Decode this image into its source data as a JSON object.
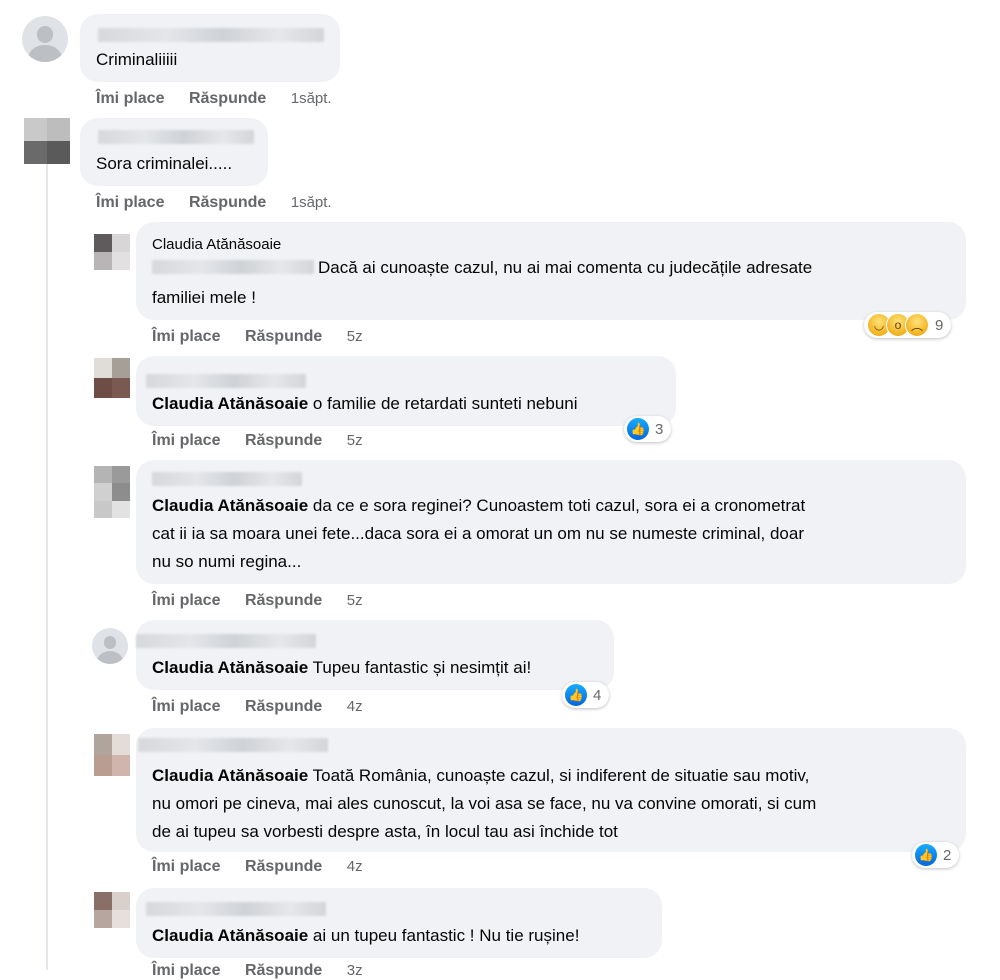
{
  "labels": {
    "like": "Îmi place",
    "reply": "Răspunde"
  },
  "comments": [
    {
      "text": "Criminaliiiii",
      "time": "1săpt."
    },
    {
      "text": "Sora criminalei.....",
      "time": "1săpt."
    },
    {
      "author": "Claudia Atănăsoaie",
      "text": "Dacă ai cunoaște cazul, nu ai mai comenta cu judecățile adresate",
      "text2": "familiei mele !",
      "time": "5z",
      "reactions": {
        "count": "9",
        "icons": [
          "haha-icon",
          "wow-icon",
          "sad-icon"
        ]
      }
    },
    {
      "mention": "Claudia Atănăsoaie",
      "text": " o familie de retardati sunteti nebuni",
      "time": "5z",
      "reactions": {
        "count": "3",
        "icons": [
          "like-icon"
        ]
      }
    },
    {
      "mention": "Claudia Atănăsoaie",
      "text": " da ce e sora reginei? Cunoastem toti cazul, sora ei a cronometrat",
      "text2": "cat ii ia sa moara unei fete...daca sora ei a omorat un om nu se numeste criminal, doar",
      "text3": "nu so numi regina...",
      "time": "5z"
    },
    {
      "mention": "Claudia Atănăsoaie",
      "text": " Tupeu fantastic și nesimțit ai!",
      "time": "4z",
      "reactions": {
        "count": "4",
        "icons": [
          "like-icon"
        ]
      }
    },
    {
      "mention": "Claudia Atănăsoaie",
      "text": " Toată România, cunoaște cazul, si indiferent de situatie sau motiv,",
      "text2": "nu omori pe cineva, mai ales cunoscut, la voi asa se face, nu va convine omorati, si cum",
      "text3": "de ai tupeu sa vorbesti despre asta, în locul tau asi închide tot",
      "time": "4z",
      "reactions": {
        "count": "2",
        "icons": [
          "like-icon"
        ]
      }
    },
    {
      "mention": "Claudia Atănăsoaie",
      "text": " ai un tupeu fantastic ! Nu tie rușine!",
      "time": "3z"
    }
  ],
  "colors": {
    "bubble": "#f0f2f5",
    "meta": "#65676b",
    "like_blue": "#0866ff"
  }
}
